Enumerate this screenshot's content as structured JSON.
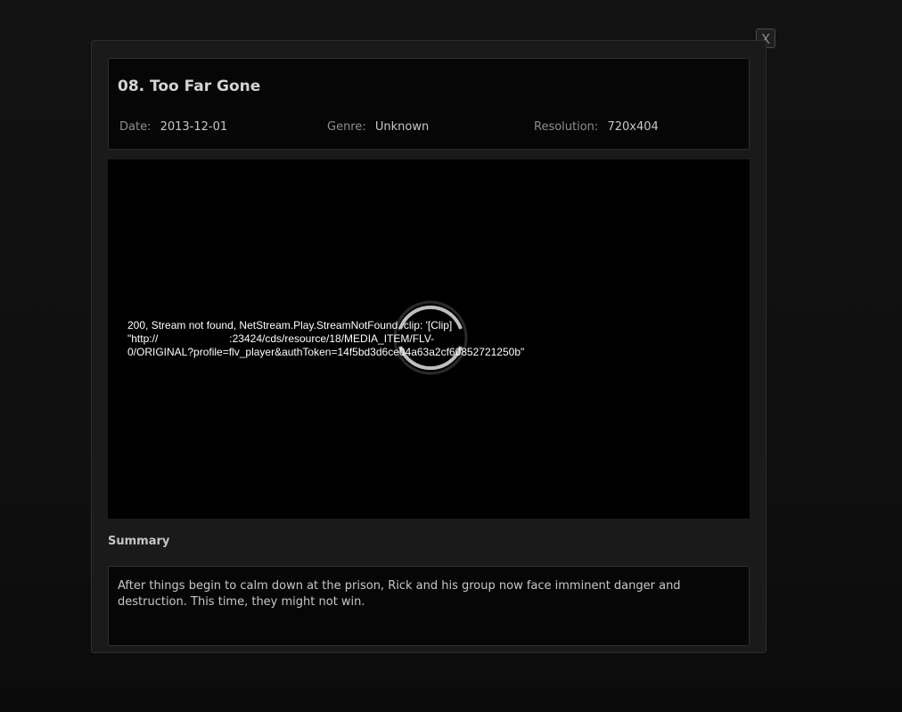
{
  "close_button": {
    "label": "X"
  },
  "episode": {
    "title": "08. Too Far Gone",
    "meta": [
      {
        "label": "Date:",
        "value": "2013-12-01"
      },
      {
        "label": "Genre:",
        "value": "Unknown"
      },
      {
        "label": "Resolution:",
        "value": "720x404"
      }
    ]
  },
  "player": {
    "error_message": "200, Stream not found, NetStream.Play.StreamNotFound, clip: '[Clip]\n\"http://                        :23424/cds/resource/18/MEDIA_ITEM/FLV-\n0/ORIGINAL?profile=flv_player&authToken=14f5bd3d6ce04a63a2cf60852721250b\""
  },
  "summary": {
    "heading": "Summary",
    "text": "After things begin to calm down at the prison, Rick and his group now face imminent danger and destruction. This time, they might not win."
  },
  "colors": {
    "page_background": "#0f0f0f",
    "modal_background": "#1a1a1a",
    "panel_background": "#060606",
    "player_background": "#000000",
    "spinner": "#bfbfbf"
  }
}
